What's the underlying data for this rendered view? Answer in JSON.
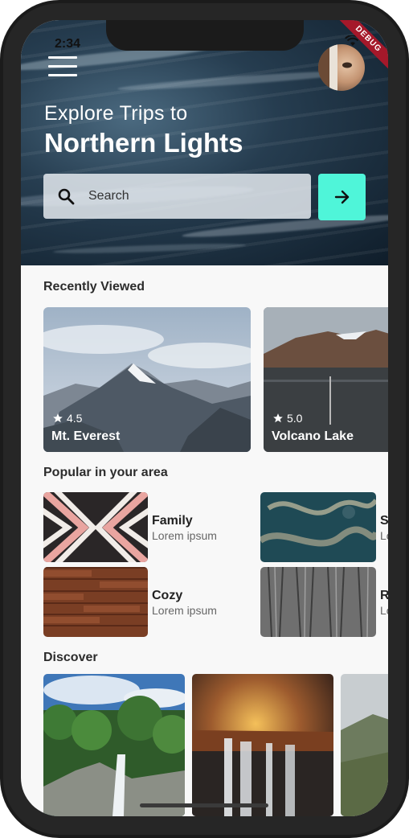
{
  "status": {
    "time": "2:34",
    "debug_label": "DEBUG"
  },
  "header": {
    "eyebrow": "Explore Trips to",
    "headline": "Northern Lights",
    "search": {
      "placeholder": "Search"
    }
  },
  "recently_viewed": {
    "title": "Recently Viewed",
    "cards": [
      {
        "name": "Mt. Everest",
        "rating": "4.5"
      },
      {
        "name": "Volcano Lake",
        "rating": "5.0"
      }
    ]
  },
  "popular": {
    "title": "Popular in your area",
    "items": [
      {
        "title": "Family",
        "subtitle": "Lorem ipsum"
      },
      {
        "title": "S",
        "subtitle": "Lo"
      },
      {
        "title": "Cozy",
        "subtitle": "Lorem ipsum"
      },
      {
        "title": "R",
        "subtitle": "Lo"
      }
    ]
  },
  "discover": {
    "title": "Discover"
  },
  "colors": {
    "accent": "#4ff5d9",
    "hero_dark": "#0f1d2a",
    "debug_ribbon": "#a5182a"
  },
  "icons": [
    "menu-icon",
    "search-icon",
    "arrow-right-icon",
    "star-icon",
    "wifi-icon",
    "battery-icon"
  ]
}
